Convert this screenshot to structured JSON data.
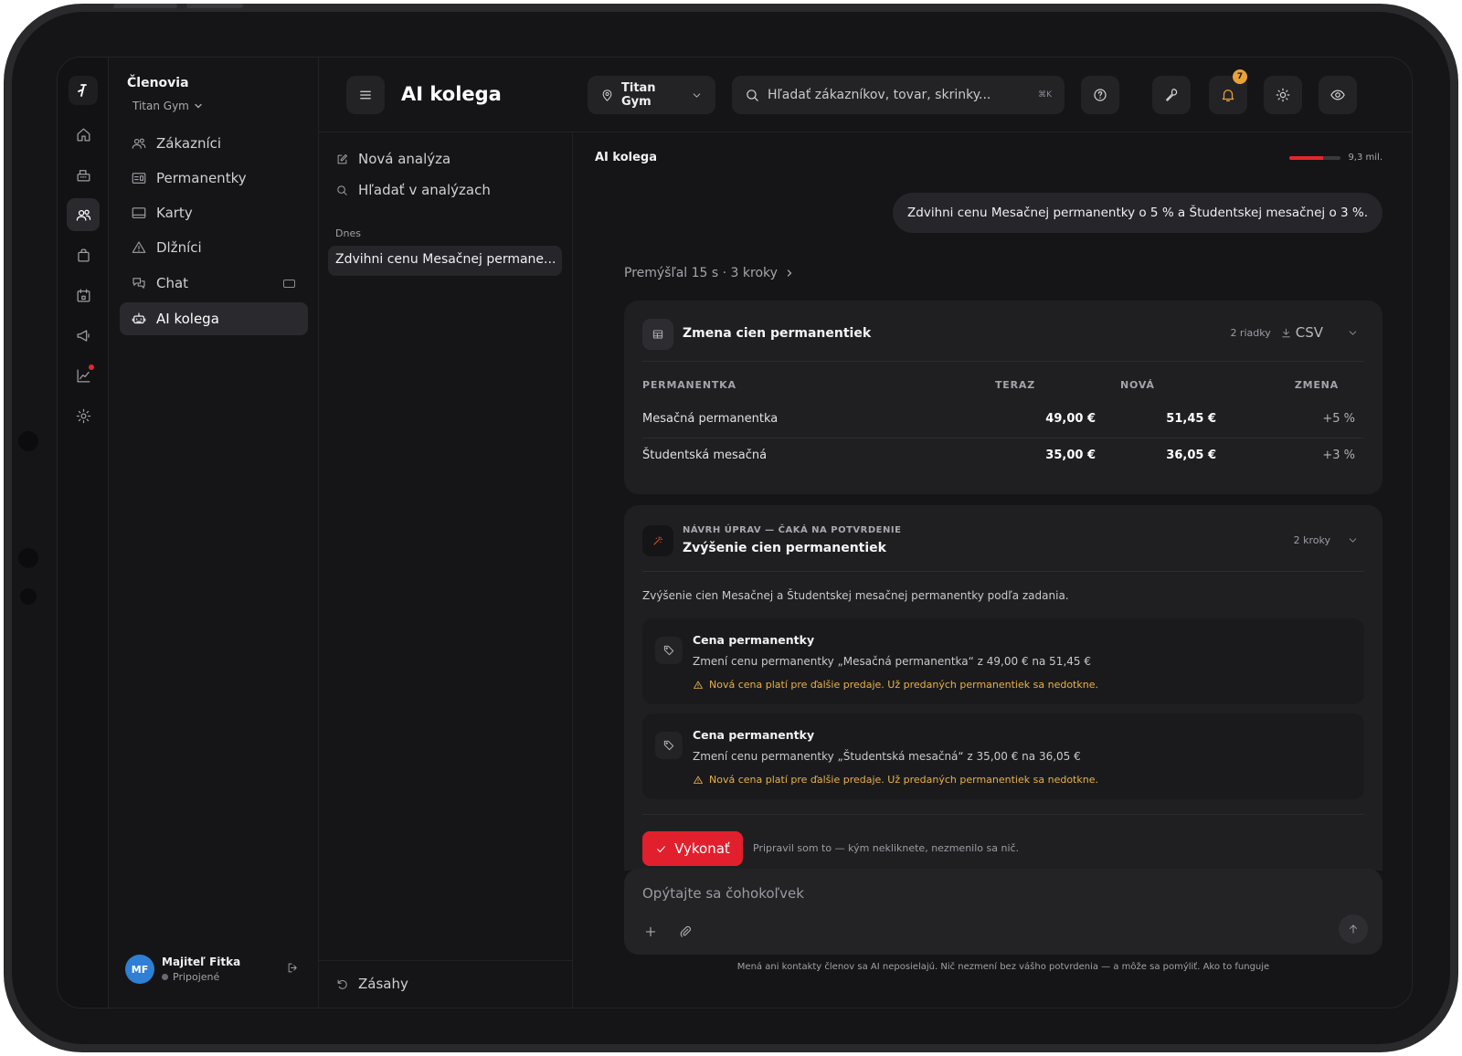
{
  "rail": {
    "items": [
      "home",
      "pos",
      "members",
      "shop",
      "calendar",
      "campaigns",
      "reports",
      "settings"
    ]
  },
  "sidebar": {
    "title": "Členovia",
    "gym": "Titan Gym",
    "items": [
      {
        "label": "Zákazníci",
        "icon": "users-icon"
      },
      {
        "label": "Permanentky",
        "icon": "membership-card-icon"
      },
      {
        "label": "Karty",
        "icon": "card-icon"
      },
      {
        "label": "Dlžníci",
        "icon": "warning-icon"
      },
      {
        "label": "Chat",
        "icon": "chat-icon"
      },
      {
        "label": "AI kolega",
        "icon": "robot-icon",
        "active": true
      }
    ],
    "user": {
      "initials": "MF",
      "name": "Majiteľ Fitka",
      "status": "Pripojené"
    }
  },
  "header": {
    "title": "AI kolega",
    "gym_select": "Titan Gym",
    "search_placeholder": "Hľadať zákazníkov, tovar, skrinky...",
    "search_shortcut": "⌘K",
    "notification_count": "7"
  },
  "history": {
    "new_analysis": "Nová analýza",
    "search_analyses": "Hľadať v analýzach",
    "section_today": "Dnes",
    "conversations": [
      "Zdvihni cenu Mesačnej permane..."
    ],
    "footer_label": "Zásahy"
  },
  "chat": {
    "title": "AI kolega",
    "usage_label": "9,3 mil.",
    "usage_fraction": 0.65,
    "user_message": "Zdvihni cenu Mesačnej permanentky o 5 % a Študentskej mesačnej o 3 %.",
    "thinking": "Premýšľal 15 s · 3 kroky",
    "table_card": {
      "title": "Zmena cien permanentiek",
      "rows_count": "2 riadky",
      "csv_label": "CSV",
      "columns": [
        "PERMANENTKA",
        "TERAZ",
        "NOVÁ",
        "ZMENA"
      ],
      "rows": [
        [
          "Mesačná permanentka",
          "49,00 €",
          "51,45 €",
          "+5 %"
        ],
        [
          "Študentská mesačná",
          "35,00 €",
          "36,05 €",
          "+3 %"
        ]
      ]
    },
    "proposal": {
      "kicker": "NÁVRH ÚPRAV — ČAKÁ NA POTVRDENIE",
      "title": "Zvýšenie cien permanentiek",
      "steps": "2 kroky",
      "description": "Zvýšenie cien Mesačnej a Študentskej mesačnej permanentky podľa zadania.",
      "changes": [
        {
          "title": "Cena permanentky",
          "text": "Zmení cenu permanentky „Mesačná permanentka“ z 49,00 € na 51,45 €",
          "warning": "Nová cena platí pre ďalšie predaje. Už predaných permanentiek sa nedotkne."
        },
        {
          "title": "Cena permanentky",
          "text": "Zmení cenu permanentky „Študentská mesačná“ z 35,00 € na 36,05 €",
          "warning": "Nová cena platí pre ďalšie predaje. Už predaných permanentiek sa nedotkne."
        }
      ],
      "execute_label": "Vykonať",
      "execute_note": "Pripravil som to — kým nekliknete, nezmenilo sa nič."
    },
    "composer_placeholder": "Opýtajte sa čohokoľvek",
    "disclaimer": "Mená ani kontakty členov sa AI neposielajú. Nič nezmení bez vášho potvrdenia — a môže sa pomýliť. Ako to funguje"
  },
  "colors": {
    "accent": "#e21f2c",
    "warning": "#e8b04a",
    "badge": "#e8a23a",
    "avatar": "#2f7fd4",
    "background": "#151517"
  }
}
